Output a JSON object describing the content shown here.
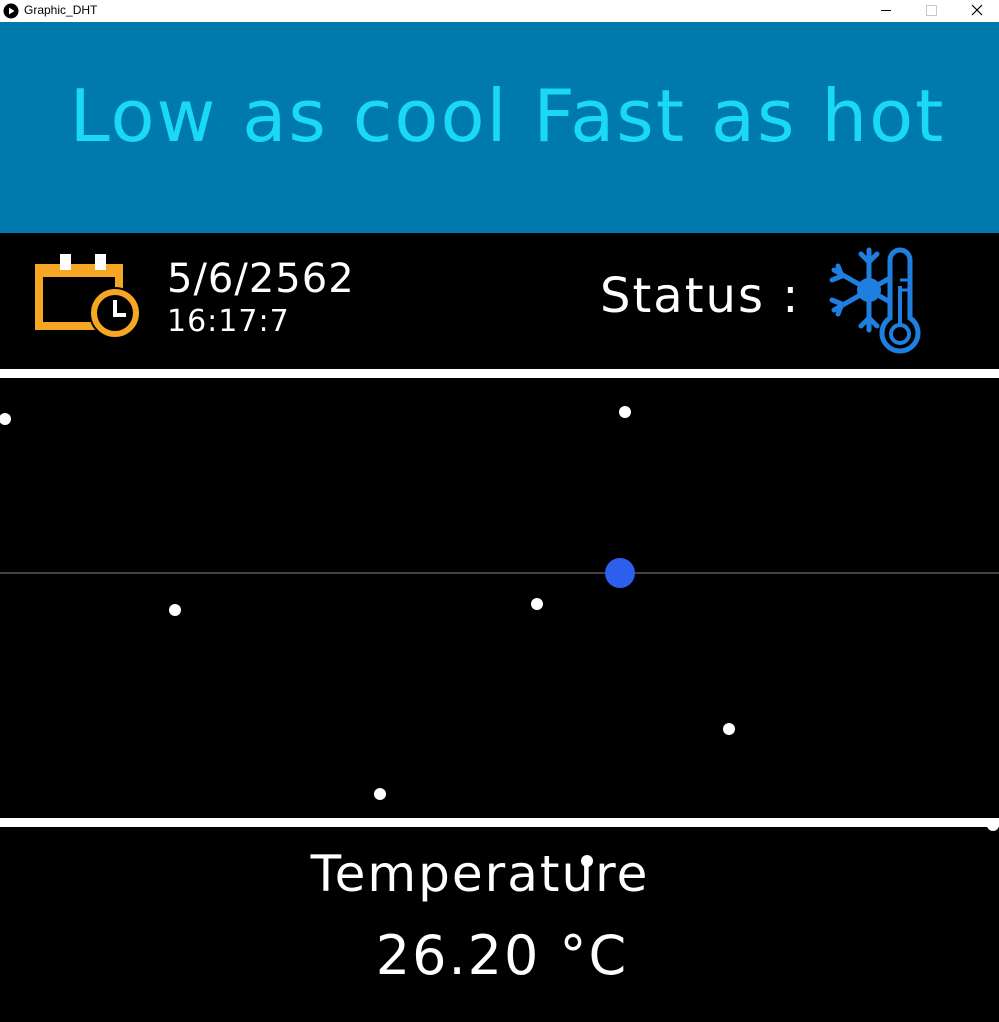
{
  "window": {
    "title": "Graphic_DHT",
    "controls": [
      "minimize-icon",
      "maximize-icon",
      "close-icon"
    ]
  },
  "banner": {
    "text": "Low as cool Fast as hot",
    "background": "#0079ad",
    "color": "#19d9f7"
  },
  "info": {
    "date": "5/6/2562",
    "time": "16:17:7",
    "status_label": "Status :",
    "status_icon": "snowflake-thermometer-icon",
    "calendar_icon": "calendar-clock-icon",
    "calendar_color": "#f5a623",
    "status_color": "#1e7fe0"
  },
  "graph": {
    "dot_color": "#ffffff",
    "current_dot_color": "#2e5fec",
    "midline_color": "#888888"
  },
  "temperature": {
    "label": "Temperature",
    "value": "26.20 °C"
  }
}
